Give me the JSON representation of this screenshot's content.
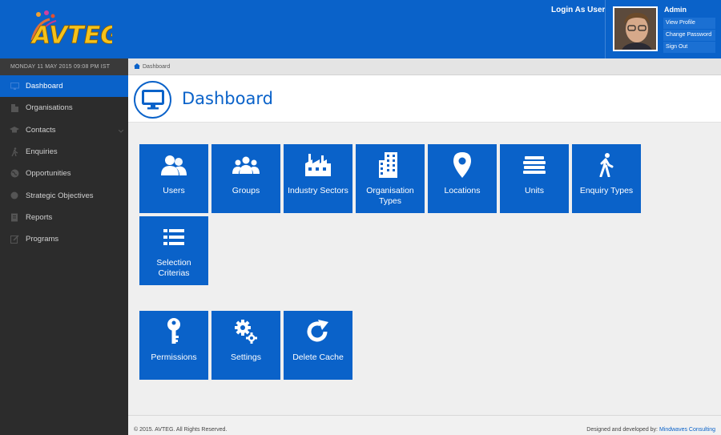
{
  "header": {
    "logo_text": "AVTEG",
    "login_as_user": "Login As User",
    "admin_name": "Admin",
    "user_menu": [
      "View Profile",
      "Change Password",
      "Sign Out"
    ],
    "brand_color": "#0a62c9"
  },
  "sidebar": {
    "date": "MONDAY 11 MAY 2015 09:08 PM IST",
    "items": [
      {
        "label": "Dashboard",
        "icon": "monitor-icon",
        "active": true
      },
      {
        "label": "Organisations",
        "icon": "building-icon"
      },
      {
        "label": "Contacts",
        "icon": "graduation-cap-icon",
        "has_chevron": true
      },
      {
        "label": "Enquiries",
        "icon": "walking-person-icon"
      },
      {
        "label": "Opportunities",
        "icon": "globe-icon"
      },
      {
        "label": "Strategic Objectives",
        "icon": "circle-icon"
      },
      {
        "label": "Reports",
        "icon": "report-icon"
      },
      {
        "label": "Programs",
        "icon": "edit-icon"
      }
    ]
  },
  "breadcrumb": {
    "label": "Dashboard"
  },
  "page": {
    "title": "Dashboard"
  },
  "tiles": [
    {
      "label": "Users",
      "icon": "users-icon"
    },
    {
      "label": "Groups",
      "icon": "groups-icon"
    },
    {
      "label": "Industry Sectors",
      "icon": "factory-icon"
    },
    {
      "label": "Organisation Types",
      "icon": "building-icon"
    },
    {
      "label": "Locations",
      "icon": "map-marker-icon"
    },
    {
      "label": "Units",
      "icon": "stack-icon"
    },
    {
      "label": "Enquiry Types",
      "icon": "walking-person-icon"
    },
    {
      "label": "Selection Criterias",
      "icon": "list-icon"
    },
    {
      "label": "Permissions",
      "icon": "key-icon"
    },
    {
      "label": "Settings",
      "icon": "cogs-icon"
    },
    {
      "label": "Delete Cache",
      "icon": "refresh-icon"
    }
  ],
  "footer": {
    "copyright": "© 2015. AVTEG. All Rights Reserved.",
    "developed_by_prefix": "Designed and developed by:",
    "developer": "Mindwaves Consulting"
  }
}
